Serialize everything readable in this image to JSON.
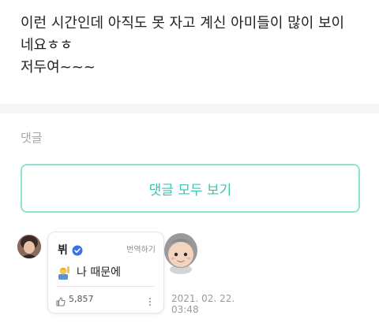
{
  "post": {
    "lines": [
      "이런 시간인데 아직도 못 자고 계신 아미들이 많이 보이",
      "네요ㅎㅎ",
      "저두여~~~"
    ]
  },
  "comments_section": {
    "label": "댓글",
    "view_all_label": "댓글 모두 보기"
  },
  "comment": {
    "author": "뷔",
    "translate_label": "번역하기",
    "text": "나 때문에",
    "like_count": "5,857",
    "timestamp_date": "2021. 02. 22.",
    "timestamp_time": "03:48",
    "icons": {
      "avatar": "user-avatar",
      "verified": "verified-badge-icon",
      "emoji": "person-raising-hand-emoji-icon",
      "like": "thumbs-up-icon",
      "more": "more-options-icon",
      "sticker": "character-sticker"
    }
  },
  "colors": {
    "accent": "#3cc3ad",
    "accent_border": "#8ee4d3",
    "verified_blue": "#3b73e6",
    "divider": "#f5f6f8",
    "muted_text": "#a7a7a7"
  }
}
